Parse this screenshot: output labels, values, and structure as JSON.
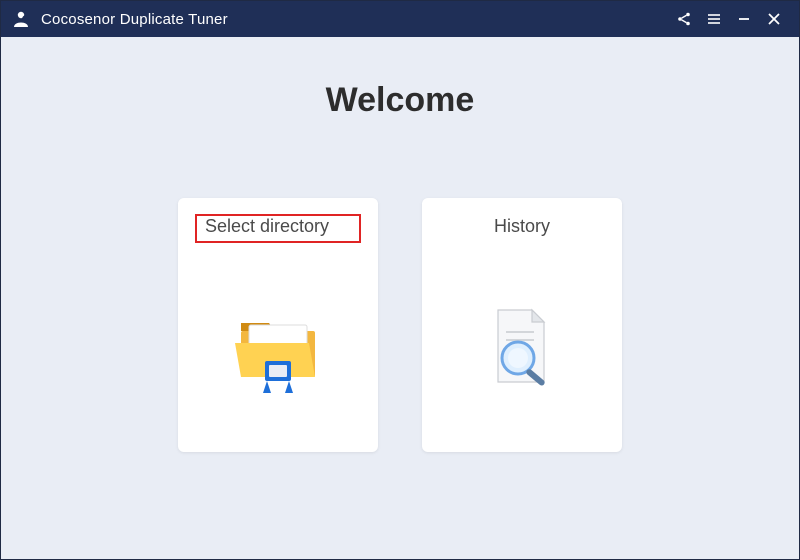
{
  "titlebar": {
    "app_name": "Cocosenor Duplicate Tuner"
  },
  "main": {
    "heading": "Welcome",
    "cards": [
      {
        "label": "Select directory",
        "icon": "folder-explorer-icon",
        "highlighted": true
      },
      {
        "label": "History",
        "icon": "document-search-icon",
        "highlighted": false
      }
    ]
  },
  "colors": {
    "titlebar_bg": "#1f2f57",
    "body_bg": "#e9edf5",
    "highlight_border": "#e02424"
  }
}
